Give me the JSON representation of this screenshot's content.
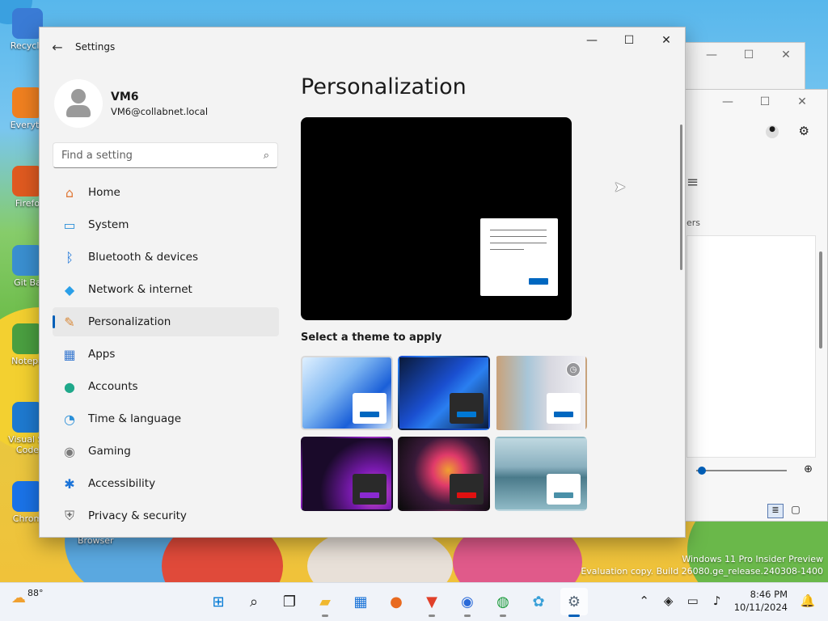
{
  "desktop": {
    "icons": [
      {
        "label": "Recycle",
        "icon": "recycle-bin-icon",
        "color": "#3a7bd5"
      },
      {
        "label": "Everyth",
        "icon": "search-app-icon",
        "color": "#f08020"
      },
      {
        "label": "Firefo",
        "icon": "firefox-icon",
        "color": "#e05a20"
      },
      {
        "label": "Git Ba",
        "icon": "git-bash-icon",
        "color": "#3a8fd0"
      },
      {
        "label": "Notepa",
        "icon": "notepad-icon",
        "color": "#4a9f40"
      },
      {
        "label": "Visual St Code",
        "icon": "vscode-icon",
        "color": "#1e7ad0"
      },
      {
        "label": "Chrom",
        "icon": "chrome-icon",
        "color": "#1a73e8"
      }
    ],
    "watermark_line1": "Windows 11 Pro Insider Preview",
    "watermark_line2": "Evaluation copy. Build 26080.ge_release.240308-1400",
    "browser_label": "Browser",
    "partial_label": "ers"
  },
  "window": {
    "title": "Settings",
    "back_glyph": "←",
    "minimize_glyph": "—",
    "maximize_glyph": "☐",
    "close_glyph": "✕"
  },
  "profile": {
    "name": "VM6",
    "email": "VM6@collabnet.local"
  },
  "search": {
    "placeholder": "Find a setting"
  },
  "nav": [
    {
      "label": "Home",
      "icon": "home-icon",
      "glyph": "⌂",
      "color": "#e07a3a",
      "selected": false
    },
    {
      "label": "System",
      "icon": "system-icon",
      "glyph": "▭",
      "color": "#2a8fd8",
      "selected": false
    },
    {
      "label": "Bluetooth & devices",
      "icon": "bluetooth-icon",
      "glyph": "ᛒ",
      "color": "#1a73d8",
      "selected": false
    },
    {
      "label": "Network & internet",
      "icon": "wifi-icon",
      "glyph": "◆",
      "color": "#2a9fe8",
      "selected": false
    },
    {
      "label": "Personalization",
      "icon": "paintbrush-icon",
      "glyph": "✎",
      "color": "#d8893a",
      "selected": true
    },
    {
      "label": "Apps",
      "icon": "apps-icon",
      "glyph": "▦",
      "color": "#3a7ad0",
      "selected": false
    },
    {
      "label": "Accounts",
      "icon": "accounts-icon",
      "glyph": "●",
      "color": "#1fa88a",
      "selected": false
    },
    {
      "label": "Time & language",
      "icon": "globe-clock-icon",
      "glyph": "◔",
      "color": "#2a8fd8",
      "selected": false
    },
    {
      "label": "Gaming",
      "icon": "gamepad-icon",
      "glyph": "◉",
      "color": "#7a7a7a",
      "selected": false
    },
    {
      "label": "Accessibility",
      "icon": "accessibility-icon",
      "glyph": "✱",
      "color": "#1a73d8",
      "selected": false
    },
    {
      "label": "Privacy & security",
      "icon": "shield-icon",
      "glyph": "⛨",
      "color": "#6a6a6a",
      "selected": false
    }
  ],
  "content": {
    "title": "Personalization",
    "theme_section_label": "Select a theme to apply",
    "themes": [
      {
        "name": "windows-light",
        "bg": "linear-gradient(135deg,#dff0ff 0%,#7fb7f2 40%,#1a5fd8 70%,#cfe3f9 100%)",
        "mini_bg": "#ffffff",
        "accent": "#0067c0",
        "selected": true,
        "badge": false
      },
      {
        "name": "windows-dark",
        "bg": "linear-gradient(135deg,#0a1a3a 0%,#1a4fd0 45%,#2a7ff0 60%,#0a1a3a 100%)",
        "mini_bg": "#2a2a2a",
        "accent": "#0078d4",
        "selected": false,
        "badge": false
      },
      {
        "name": "spotlight",
        "bg": "linear-gradient(90deg,#c9a27a 0%,#a8c6d8 35%,#d8d8e0 60%,#f0f0f4 100%)",
        "mini_bg": "#ffffff",
        "accent": "#0067c0",
        "selected": false,
        "badge": true
      },
      {
        "name": "glow",
        "bg": "radial-gradient(circle at 80% 75%,#e05ad0 0%,#7a1ab0 25%,#1a0a2a 60%)",
        "mini_bg": "#2a2a2a",
        "accent": "#8a2ad0",
        "selected": false,
        "badge": false
      },
      {
        "name": "captured-motion",
        "bg": "radial-gradient(circle at 55% 45%,#f0a030 0%,#e03a6a 25%,#3a1a3a 55%,#0a0a0a 100%)",
        "mini_bg": "#2a2a2a",
        "accent": "#e01010",
        "selected": false,
        "badge": false
      },
      {
        "name": "flow",
        "bg": "linear-gradient(180deg,#bfd8e0 0%,#8ab0bf 40%,#4a7a8a 55%,#8fbac6 100%)",
        "mini_bg": "#ffffff",
        "accent": "#4a90a8",
        "selected": false,
        "badge": false
      }
    ]
  },
  "taskbar": {
    "temperature": "88°",
    "time": "8:46 PM",
    "date": "10/11/2024",
    "apps": [
      {
        "icon": "windows-start-icon",
        "glyph": "⊞",
        "color": "#0078d4",
        "running": false,
        "active": false
      },
      {
        "icon": "search-icon",
        "glyph": "⌕",
        "color": "#222222",
        "running": false,
        "active": false
      },
      {
        "icon": "task-view-icon",
        "glyph": "❐",
        "color": "#222222",
        "running": false,
        "active": false
      },
      {
        "icon": "file-explorer-icon",
        "glyph": "▰",
        "color": "#f0b830",
        "running": true,
        "active": false
      },
      {
        "icon": "store-icon",
        "glyph": "▦",
        "color": "#1a73d8",
        "running": false,
        "active": false
      },
      {
        "icon": "firefox-icon",
        "glyph": "●",
        "color": "#e86a20",
        "running": false,
        "active": false
      },
      {
        "icon": "brave-icon",
        "glyph": "▼",
        "color": "#e0402a",
        "running": true,
        "active": false
      },
      {
        "icon": "browser-icon",
        "glyph": "◉",
        "color": "#2a6ad8",
        "running": true,
        "active": false
      },
      {
        "icon": "chrome-icon",
        "glyph": "◍",
        "color": "#1a9a3a",
        "running": true,
        "active": false
      },
      {
        "icon": "paint-icon",
        "glyph": "✿",
        "color": "#3aa0d8",
        "running": false,
        "active": false
      },
      {
        "icon": "settings-icon",
        "glyph": "⚙",
        "color": "#5a6a7a",
        "running": true,
        "active": true
      }
    ]
  }
}
